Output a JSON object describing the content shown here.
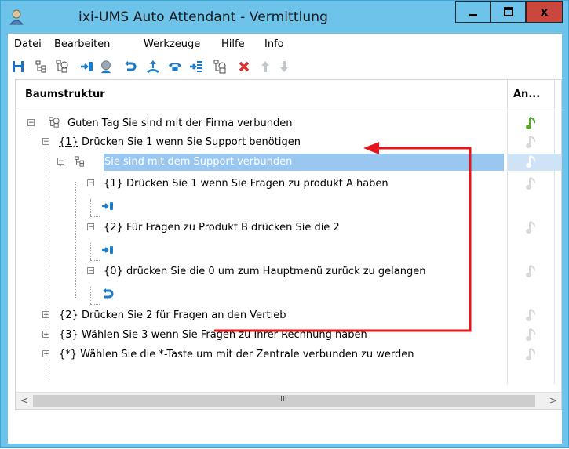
{
  "window": {
    "title": "ixi-UMS Auto Attendant - Vermittlung",
    "buttons": {
      "minimize": "▁",
      "maximize": "□",
      "close": "x"
    }
  },
  "menu": [
    "Datei",
    "Bearbeiten",
    "Werkzeuge",
    "Hilfe",
    "Info"
  ],
  "toolbar": [
    {
      "icon": "save-icon",
      "enabled": true
    },
    {
      "icon": "tree-icon",
      "enabled": true
    },
    {
      "icon": "tree-node-icon",
      "enabled": true
    },
    {
      "icon": "transfer-icon",
      "enabled": true
    },
    {
      "icon": "operator-icon",
      "enabled": true
    },
    {
      "icon": "back-icon",
      "enabled": true
    },
    {
      "icon": "forward-call-icon",
      "enabled": true
    },
    {
      "icon": "hangup-icon",
      "enabled": true
    },
    {
      "icon": "menu-option-icon",
      "enabled": true
    },
    {
      "icon": "settings-node-icon",
      "enabled": true
    },
    {
      "icon": "delete-icon",
      "enabled": true
    },
    {
      "icon": "move-up-icon",
      "enabled": false
    },
    {
      "icon": "move-down-icon",
      "enabled": false
    }
  ],
  "tree": {
    "columns": [
      "Baumstruktur",
      "An..."
    ],
    "rows": [
      {
        "key": "",
        "text": "Guten Tag Sie sind mit der Firma verbunden",
        "note_color": "#5aa626"
      },
      {
        "key": "{1}",
        "text": "Drücken Sie 1 wenn Sie Support benötigen",
        "note_color": "#d8d8d8"
      },
      {
        "key": "",
        "text": "Sie sind mit dem Support verbunden",
        "note_color": "#ffffff"
      },
      {
        "key": "{1}",
        "text": "Drücken Sie 1 wenn Sie Fragen zu produkt A haben",
        "note_color": "#d8d8d8"
      },
      {
        "key": "",
        "text": "",
        "note_color": ""
      },
      {
        "key": "{2}",
        "text": "Für Fragen zu Produkt B drücken Sie die 2",
        "note_color": "#d8d8d8"
      },
      {
        "key": "",
        "text": "",
        "note_color": ""
      },
      {
        "key": "{0}",
        "text": "drücken Sie die 0 um zum Hauptmenü zurück zu gelangen",
        "note_color": "#d8d8d8"
      },
      {
        "key": "",
        "text": "",
        "note_color": ""
      },
      {
        "key": "{2}",
        "text": "Drücken Sie 2 für Fragen an den Vertieb",
        "note_color": "#d8d8d8"
      },
      {
        "key": "{3}",
        "text": "Wählen Sie 3 wenn Sie Fragen zu Ihrer Rechnung haben",
        "note_color": "#d8d8d8"
      },
      {
        "key": "{*}",
        "text": "Wählen Sie die *-Taste um mit der Zentrale verbunden zu werden",
        "note_color": "#d8d8d8"
      }
    ],
    "selected_row": 2
  },
  "scrollbar": {
    "left": "<",
    "grip": "III",
    "right": ">"
  },
  "colors": {
    "titlebar": "#6dc3ea",
    "close": "#c9473d",
    "selection": "#99c7f0",
    "annotation": "#e8141b",
    "accent_icon": "#1a7cc8"
  }
}
